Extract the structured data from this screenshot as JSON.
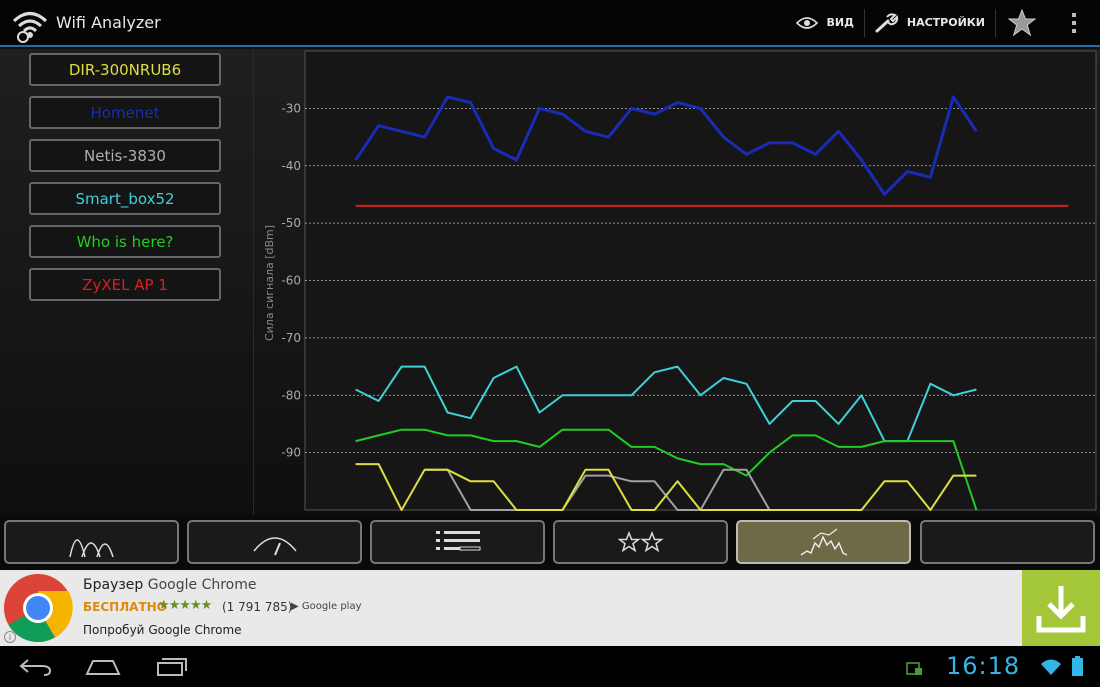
{
  "app": {
    "title": "Wifi Analyzer",
    "accent": "#2a6aa8"
  },
  "actionbar": {
    "view_label": "ВИД",
    "view_icon": "eye-icon",
    "settings_label": "НАСТРОЙКИ",
    "settings_icon": "wrench-icon",
    "favorite_icon": "star-icon",
    "overflow_icon": "overflow-menu-icon"
  },
  "legend": [
    {
      "label": "DIR-300NRUB6",
      "color": "#dede40"
    },
    {
      "label": "Homenet",
      "color": "#1a2bb5"
    },
    {
      "label": "Netis-3830",
      "color": "#b0b0b0"
    },
    {
      "label": "Smart_box52",
      "color": "#3fd0d8"
    },
    {
      "label": "Who is here?",
      "color": "#22cc22"
    },
    {
      "label": "ZyXEL AP 1",
      "color": "#d62020"
    }
  ],
  "chart_data": {
    "type": "line",
    "ylabel": "Сила сигнала [dBm]",
    "ylim": [
      -100,
      -20
    ],
    "yticks": [
      -30,
      -40,
      -50,
      -60,
      -70,
      -80,
      -90
    ],
    "x": [
      0,
      1,
      2,
      3,
      4,
      5,
      6,
      7,
      8,
      9,
      10,
      11,
      12,
      13,
      14,
      15,
      16,
      17,
      18,
      19,
      20,
      21,
      22,
      23,
      24,
      25,
      26,
      27,
      28,
      29,
      30,
      31
    ],
    "xlim": [
      -2.2,
      32.2
    ],
    "grid": true,
    "series": [
      {
        "name": "Homenet",
        "color": "#1a2bb5",
        "values": [
          -39,
          -33,
          -34,
          -35,
          -28,
          -29,
          -37,
          -39,
          -30,
          -31,
          -34,
          -35,
          -30,
          -31,
          -29,
          -30,
          -35,
          -38,
          -36,
          -36,
          -38,
          -34,
          -39,
          -45,
          -41,
          -42,
          -28,
          -34
        ]
      },
      {
        "name": "ZyXEL AP 1",
        "color": "#d62020",
        "values": [
          -47,
          -47,
          -47,
          -47,
          -47,
          -47,
          -47,
          -47,
          -47,
          -47,
          -47,
          -47,
          -47,
          -47,
          -47,
          -47,
          -47,
          -47,
          -47,
          -47,
          -47,
          -47,
          -47,
          -47,
          -47,
          -47,
          -47,
          -47,
          -47,
          -47,
          -47,
          -47
        ]
      },
      {
        "name": "Smart_box52",
        "color": "#3fd0d8",
        "values": [
          -79,
          -81,
          -75,
          -75,
          -83,
          -84,
          -77,
          -75,
          -83,
          -80,
          -80,
          -80,
          -80,
          -76,
          -75,
          -80,
          -77,
          -78,
          -85,
          -81,
          -81,
          -85,
          -80,
          -88,
          -88,
          -78,
          -80,
          -79
        ]
      },
      {
        "name": "Who is here?",
        "color": "#22cc22",
        "values": [
          -88,
          -87,
          -86,
          -86,
          -87,
          -87,
          -88,
          -88,
          -89,
          -86,
          -86,
          -86,
          -89,
          -89,
          -91,
          -92,
          -92,
          -94,
          -90,
          -87,
          -87,
          -89,
          -89,
          -88,
          -88,
          -88,
          -88,
          -101
        ]
      },
      {
        "name": "Netis-3830",
        "color": "#a0a0a0",
        "values": [
          null,
          null,
          null,
          -93,
          -93,
          -100,
          -100,
          -100,
          -100,
          -100,
          -94,
          -94,
          -95,
          -95,
          -100,
          -100,
          -93,
          -93,
          -100
        ]
      },
      {
        "name": "DIR-300NRUB6",
        "color": "#dede40",
        "values": [
          -92,
          -92,
          -100,
          -93,
          -93,
          -95,
          -95,
          -100,
          -100,
          -100,
          -93,
          -93,
          -100,
          -100,
          -95,
          -100,
          -100,
          -100,
          -100,
          -100,
          -100,
          -100,
          -100,
          -95,
          -95,
          -100,
          -94,
          -94
        ]
      }
    ]
  },
  "tabs": [
    {
      "icon": "channel-graph-icon",
      "active": false
    },
    {
      "icon": "channel-rating-icon",
      "active": false
    },
    {
      "icon": "ap-list-icon",
      "active": false
    },
    {
      "icon": "signal-meter-icon",
      "active": false
    },
    {
      "icon": "time-graph-icon",
      "active": true
    },
    {
      "icon": "blank-tab",
      "active": false
    }
  ],
  "ad": {
    "title": "Браузер",
    "title_brand": "Google Chrome",
    "price": "БЕСПЛАТНО",
    "stars": "★★★★★",
    "count": "(1 791 785)",
    "store": "Google play",
    "subtitle_prefix": "Попробуй",
    "subtitle_brand": "Google Chrome",
    "info": "i",
    "download_icon": "download-icon",
    "download_color": "#a4c639"
  },
  "status": {
    "time": "16:18",
    "icons": [
      "screenshot-icon",
      "wifi-icon",
      "battery-icon"
    ]
  },
  "nav": {
    "icons": [
      "back-icon",
      "home-icon",
      "recents-icon"
    ]
  }
}
